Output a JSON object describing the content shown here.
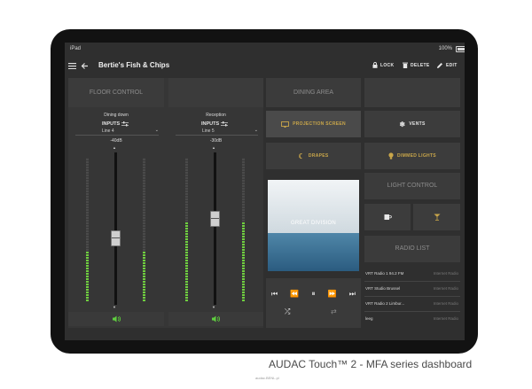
{
  "status": {
    "device": "iPad",
    "battery": "100%"
  },
  "header": {
    "title": "Bertie's Fish & Chips",
    "lock_label": "LOCK",
    "delete_label": "DELETE",
    "edit_label": "EDIT"
  },
  "floor_control": {
    "title": "FLOOR CONTROL",
    "zones": [
      {
        "name": "Dining down",
        "inputs_label": "INPUTS",
        "line": "Line 4",
        "db": "-40dB",
        "level": 0.35
      },
      {
        "name": "Reception",
        "inputs_label": "INPUTS",
        "line": "Line 5",
        "db": "-30dB",
        "level": 0.55
      }
    ]
  },
  "dining_area": {
    "title": "DINING AREA",
    "buttons": [
      {
        "label": "PROJECTION SCREEN",
        "icon": "projection-screen-icon",
        "active": true
      },
      {
        "label": "VENTS",
        "icon": "snowflake-icon",
        "active": false
      },
      {
        "label": "DRAPES",
        "icon": "moon-icon",
        "active": false
      },
      {
        "label": "DIMMED LIGHTS",
        "icon": "bulb-icon",
        "active": false
      }
    ]
  },
  "player": {
    "album_text": "GREAT DIVISION"
  },
  "light_control": {
    "title": "LIGHT CONTROL"
  },
  "radio_list": {
    "title": "RADIO LIST",
    "items": [
      {
        "name": "VRT Radio 1 94.2 FM",
        "type": "Internet Radio"
      },
      {
        "name": "VRT Studio Brussel",
        "type": "Internet Radio"
      },
      {
        "name": "VRT Radio 2 Limbur...",
        "type": "Internet Radio"
      },
      {
        "name": "leeg",
        "type": "Internet Radio"
      }
    ]
  },
  "caption": "AUDAC Touch™ 2 - MFA series dashboard",
  "footnote": "audac.BENL.pl",
  "colors": {
    "accent": "#c9a64a",
    "meter_green": "#6fcf3f",
    "background": "#2f2f2f"
  }
}
